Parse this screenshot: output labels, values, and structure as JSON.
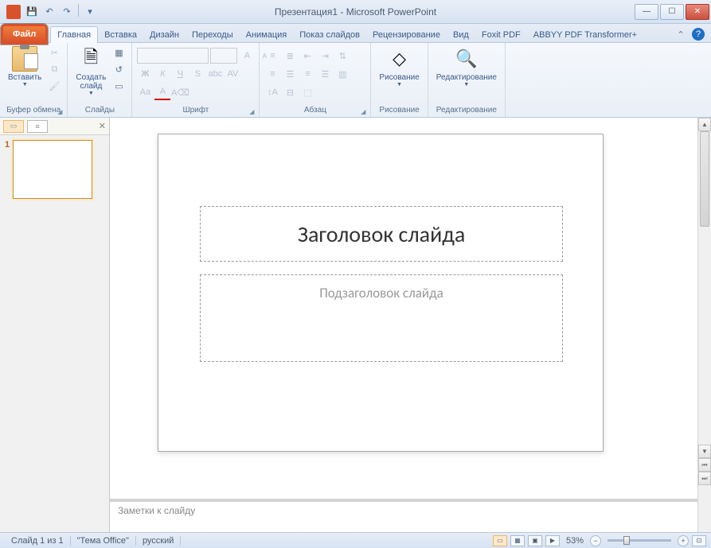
{
  "window": {
    "title": "Презентация1 - Microsoft PowerPoint"
  },
  "tabs": {
    "file": "Файл",
    "home": "Главная",
    "insert": "Вставка",
    "design": "Дизайн",
    "transitions": "Переходы",
    "animation": "Анимация",
    "slideshow": "Показ слайдов",
    "review": "Рецензирование",
    "view": "Вид",
    "foxit": "Foxit PDF",
    "abbyy": "ABBYY PDF Transformer+"
  },
  "ribbon": {
    "clipboard": {
      "label": "Буфер обмена",
      "paste": "Вставить"
    },
    "slides": {
      "label": "Слайды",
      "new_slide": "Создать\nслайд"
    },
    "font": {
      "label": "Шрифт"
    },
    "paragraph": {
      "label": "Абзац"
    },
    "drawing": {
      "label": "Рисование",
      "btn": "Рисование"
    },
    "editing": {
      "label": "Редактирование",
      "btn": "Редактирование"
    }
  },
  "sidepanel": {
    "thumb_number": "1"
  },
  "slide": {
    "title_placeholder": "Заголовок слайда",
    "subtitle_placeholder": "Подзаголовок слайда"
  },
  "notes": {
    "placeholder": "Заметки к слайду"
  },
  "status": {
    "slide_count": "Слайд 1 из 1",
    "theme": "\"Тема Office\"",
    "language": "русский",
    "zoom": "53%"
  }
}
